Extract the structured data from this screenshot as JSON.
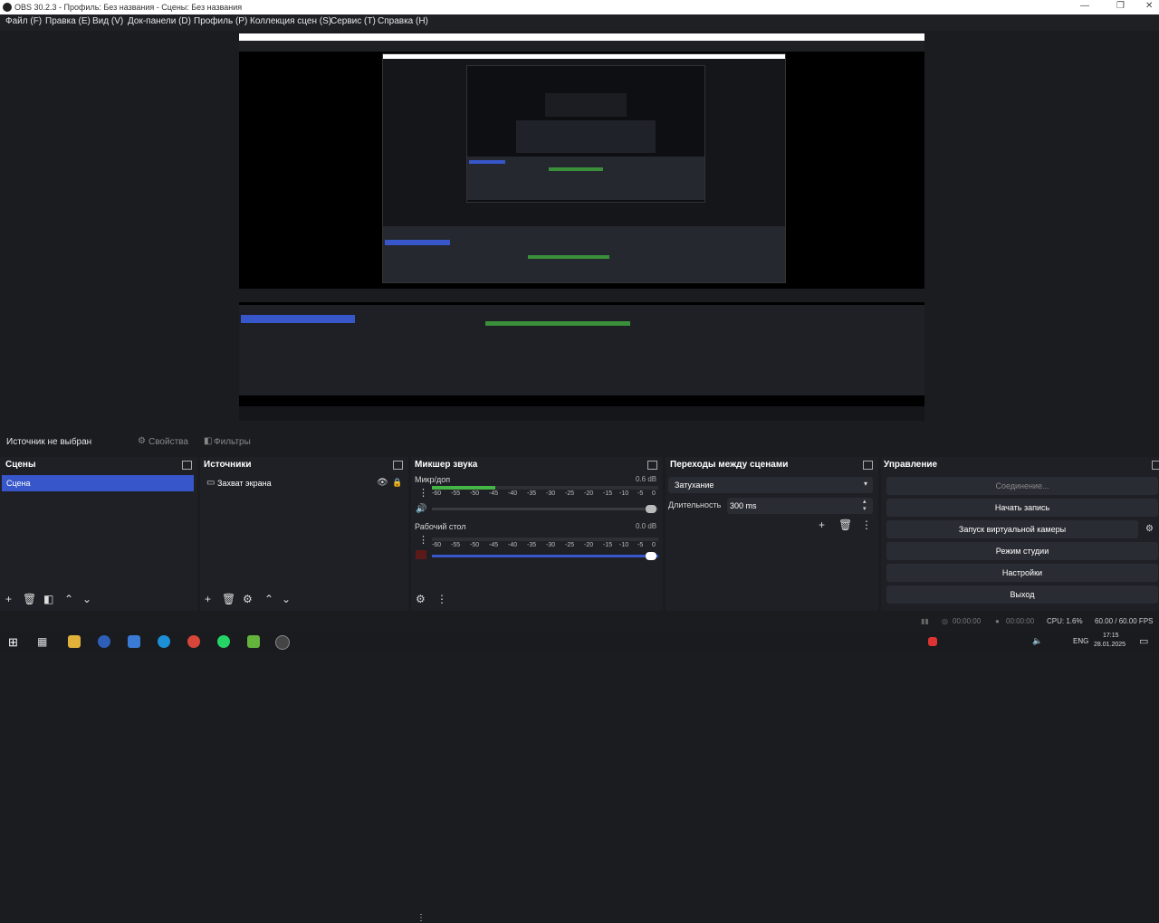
{
  "window": {
    "title": "OBS 30.2.3 - Профиль: Без названия - Сцены: Без названия"
  },
  "menu": [
    "Файл (F)",
    "Правка (E)",
    "Вид (V)",
    "Док-панели (D)",
    "Профиль (P)",
    "Коллекция сцен (S)",
    "Сервис (T)",
    "Справка (H)"
  ],
  "source_bar": {
    "no_source": "Источник не выбран",
    "properties": "Свойства",
    "filters": "Фильтры"
  },
  "scenes": {
    "title": "Сцены",
    "items": [
      "Сцена"
    ]
  },
  "sources": {
    "title": "Источники",
    "items": [
      "Захват экрана"
    ]
  },
  "mixer": {
    "title": "Микшер звука",
    "channels": [
      {
        "name": "Микр/доп",
        "db": "0.6 dB"
      },
      {
        "name": "Рабочий стол",
        "db": "0.0 dB"
      }
    ],
    "scale": [
      "-60",
      "-55",
      "-50",
      "-45",
      "-40",
      "-35",
      "-30",
      "-25",
      "-20",
      "-15",
      "-10",
      "-5",
      "0"
    ]
  },
  "transitions": {
    "title": "Переходы между сценами",
    "type": "Затухание",
    "duration_label": "Длительность",
    "duration_value": "300 ms"
  },
  "controls": {
    "title": "Управление",
    "buttons": [
      "Соединение...",
      "Начать запись",
      "Запуск виртуальной камеры",
      "Режим студии",
      "Настройки",
      "Выход"
    ]
  },
  "status": {
    "stream_time": "00:00:00",
    "rec_time": "00:00:00",
    "cpu": "CPU: 1.6%",
    "fps": "60.00 / 60.00 FPS"
  },
  "taskbar": {
    "lang": "ENG",
    "time": "17:15",
    "date": "28.01.2025"
  },
  "colors": {
    "accent": "#3656c9",
    "bg": "#1b1c20",
    "dock": "#1f2026"
  }
}
